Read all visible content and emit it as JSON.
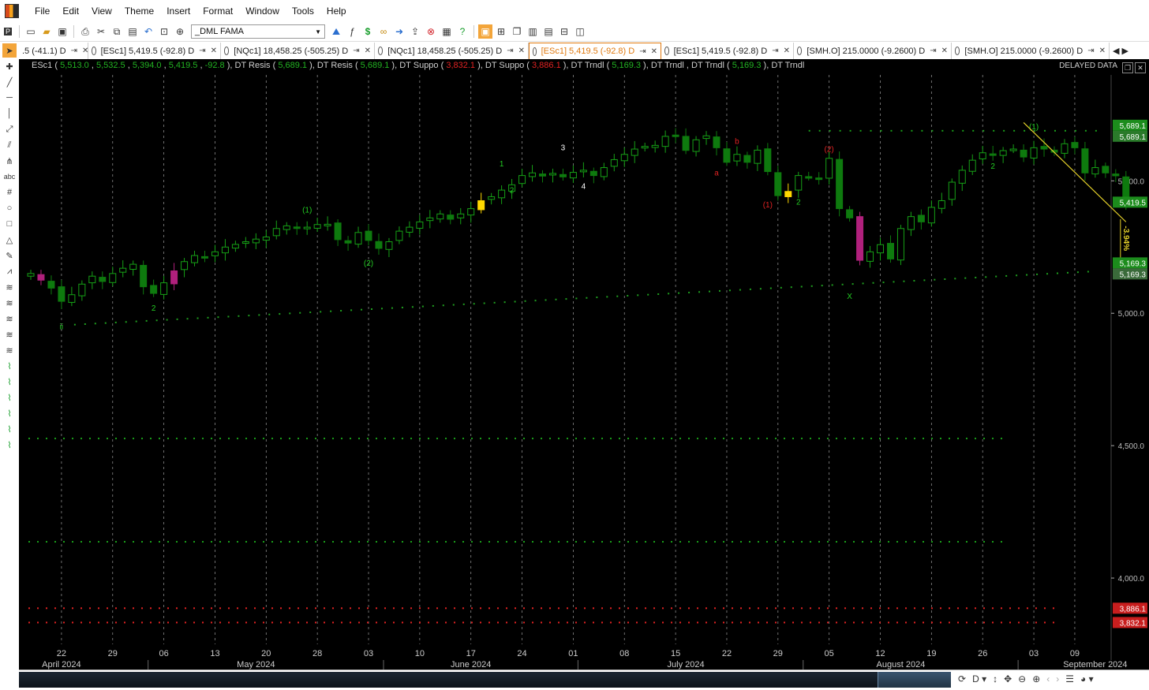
{
  "menu": [
    "File",
    "Edit",
    "View",
    "Theme",
    "Insert",
    "Format",
    "Window",
    "Tools",
    "Help"
  ],
  "toolbar": {
    "page_select": "_DML FAMA"
  },
  "tabs": [
    {
      "label": ".5 (-41.1) D",
      "active": false
    },
    {
      "label": "[ESc1] 5,419.5 (-92.8) D",
      "active": false
    },
    {
      "label": "[NQc1] 18,458.25 (-505.25) D",
      "active": false
    },
    {
      "label": "[NQc1] 18,458.25 (-505.25) D",
      "active": false
    },
    {
      "label": "[ESc1] 5,419.5 (-92.8) D",
      "active": true
    },
    {
      "label": "[ESc1] 5,419.5 (-92.8) D",
      "active": false
    },
    {
      "label": "[SMH.O] 215.0000 (-9.2600) D",
      "active": false
    },
    {
      "label": "[SMH.O] 215.0000 (-9.2600) D",
      "active": false
    }
  ],
  "left_tools": [
    "pointer-icon",
    "crosshair-icon",
    "line-icon",
    "hline-icon",
    "vline-icon",
    "ray-icon",
    "channel-icon",
    "pitchfork-icon",
    "text-icon",
    "grid-icon",
    "circle-icon",
    "rectangle-icon",
    "triangle-icon",
    "pen-icon",
    "polyline-icon",
    "wave-12345-icon",
    "wave-abc-icon",
    "wave-abcde-icon",
    "wave-wxy-icon",
    "wave-wxyxz-icon",
    "wave-1-icon",
    "wave-2-icon",
    "wave-3-icon",
    "wave-4-icon",
    "wave-5-icon",
    "wave-6-icon"
  ],
  "legend": {
    "symbol": "ESc1",
    "ohlc": [
      "5,513.0",
      "5,532.5",
      "5,394.0",
      "5,419.5",
      "-92.8"
    ],
    "studies": [
      {
        "name": "DT Resis",
        "value": "5,689.1",
        "color": "g"
      },
      {
        "name": "DT Resis",
        "value": "5,689.1",
        "color": "g"
      },
      {
        "name": "DT Suppo",
        "value": "3,832.1",
        "color": "r"
      },
      {
        "name": "DT Suppo",
        "value": "3,886.1",
        "color": "r"
      },
      {
        "name": "DT Trndl",
        "value": "5,169.3",
        "color": "g"
      },
      {
        "name": "DT Trndl",
        "value": "",
        "color": ""
      },
      {
        "name": "DT Trndl",
        "value": "5,169.3",
        "color": "g"
      },
      {
        "name": "DT Trndl",
        "value": "",
        "color": ""
      }
    ]
  },
  "delayed_label": "DELAYED DATA",
  "chart_data": {
    "type": "candlestick",
    "symbol": "ESc1",
    "ylim": [
      3750,
      5900
    ],
    "y_ticks": [
      {
        "value": 4000,
        "label": "4,000.0"
      },
      {
        "value": 4500,
        "label": "4,500.0"
      },
      {
        "value": 5000,
        "label": "5,000.0"
      },
      {
        "value": 5500,
        "label": "5,500.0"
      }
    ],
    "x_ticks": [
      "22",
      "29",
      "06",
      "13",
      "20",
      "28",
      "03",
      "10",
      "17",
      "24",
      "01",
      "08",
      "15",
      "22",
      "29",
      "05",
      "12",
      "19",
      "26",
      "03",
      "09"
    ],
    "x_tick_bars": [
      3,
      8,
      13,
      18,
      23,
      28,
      33,
      38,
      43,
      48,
      53,
      58,
      63,
      68,
      73,
      78,
      83,
      88,
      93,
      98,
      102
    ],
    "months": [
      {
        "label": "April 2024",
        "bar": 3
      },
      {
        "label": "May 2024",
        "bar": 22
      },
      {
        "label": "June 2024",
        "bar": 43
      },
      {
        "label": "July 2024",
        "bar": 64
      },
      {
        "label": "August 2024",
        "bar": 85
      },
      {
        "label": "September 2024",
        "bar": 104
      }
    ],
    "closes": [
      5150,
      5125,
      5095,
      5045,
      5070,
      5110,
      5140,
      5120,
      5150,
      5170,
      5185,
      5100,
      5075,
      5115,
      5160,
      5195,
      5218,
      5212,
      5232,
      5250,
      5260,
      5270,
      5280,
      5288,
      5320,
      5330,
      5320,
      5325,
      5335,
      5336,
      5278,
      5265,
      5305,
      5275,
      5245,
      5270,
      5310,
      5325,
      5345,
      5360,
      5375,
      5355,
      5375,
      5395,
      5425,
      5440,
      5465,
      5485,
      5520,
      5530,
      5518,
      5528,
      5515,
      5532,
      5540,
      5520,
      5550,
      5580,
      5600,
      5620,
      5630,
      5634,
      5668,
      5672,
      5615,
      5655,
      5670,
      5625,
      5570,
      5600,
      5570,
      5616,
      5535,
      5444,
      5460,
      5520,
      5515,
      5505,
      5585,
      5395,
      5360,
      5200,
      5232,
      5259,
      5205,
      5320,
      5365,
      5345,
      5400,
      5425,
      5495,
      5540,
      5578,
      5606,
      5600,
      5614,
      5620,
      5590,
      5625,
      5620,
      5608,
      5640,
      5625,
      5530,
      5550,
      5530,
      5519,
      5419.5
    ],
    "colors": {
      "up": "#16a016",
      "down": "#0e7a0e",
      "magenta": "#b0207c",
      "yellow": "#ffd800"
    },
    "special_bars": {
      "magenta": [
        1,
        81
      ],
      "yellow": [
        44
      ],
      "magenta_early": [
        14
      ],
      "yellow_late": [
        74
      ]
    },
    "resistance": {
      "value": 5689.1,
      "label": "5,689.1",
      "from_bar": 76,
      "to_bar": 104
    },
    "support1": {
      "value": 3886.1,
      "label": "3,886.1",
      "color": "#e02222"
    },
    "support2": {
      "value": 3832.1,
      "label": "3,832.1",
      "color": "#e02222"
    },
    "trendline": {
      "value": 5169.3,
      "label": "5,169.3",
      "from": [
        4,
        4960
      ],
      "to": [
        103,
        5160
      ]
    },
    "green_dotted_low": [
      4530,
      4140
    ],
    "last_price": {
      "value": 5419.5,
      "label": "5,419.5"
    },
    "pct_change_label": "-3.94%",
    "wave_labels": [
      {
        "bar": 3,
        "value": 4940,
        "text": "ii",
        "color": "#22cc22"
      },
      {
        "bar": 12,
        "value": 5010,
        "text": "2",
        "color": "#22cc22"
      },
      {
        "bar": 27,
        "value": 5380,
        "text": "(1)",
        "color": "#22cc22"
      },
      {
        "bar": 33,
        "value": 5180,
        "text": "(2)",
        "color": "#22cc22"
      },
      {
        "bar": 46,
        "value": 5555,
        "text": "1",
        "color": "#22cc22"
      },
      {
        "bar": 47,
        "value": 5455,
        "text": "2",
        "color": "#22cc22"
      },
      {
        "bar": 52,
        "value": 5615,
        "text": "3",
        "color": "#ffffff"
      },
      {
        "bar": 54,
        "value": 5470,
        "text": "4",
        "color": "#ffffff"
      },
      {
        "bar": 67,
        "value": 5520,
        "text": "a",
        "color": "#e02222"
      },
      {
        "bar": 69,
        "value": 5640,
        "text": "b",
        "color": "#e02222"
      },
      {
        "bar": 72,
        "value": 5400,
        "text": "(1)",
        "color": "#e02222"
      },
      {
        "bar": 75,
        "value": 5410,
        "text": "2",
        "color": "#22cc22"
      },
      {
        "bar": 78,
        "value": 5610,
        "text": "(2)",
        "color": "#e02222"
      },
      {
        "bar": 80,
        "value": 5055,
        "text": "X",
        "color": "#22cc22"
      },
      {
        "bar": 94,
        "value": 5545,
        "text": "2",
        "color": "#22cc22"
      },
      {
        "bar": 98,
        "value": 5695,
        "text": "(1)",
        "color": "#22cc22"
      }
    ]
  }
}
